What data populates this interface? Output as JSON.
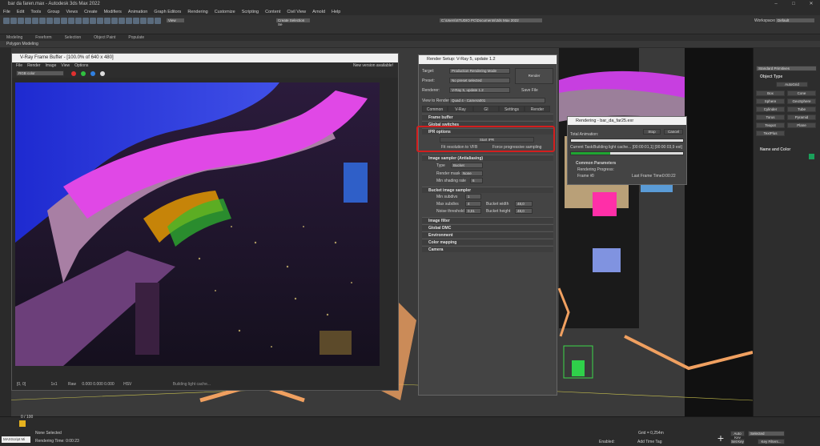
{
  "app": {
    "title": "bar da faren.max - Autodesk 3ds Max 2022"
  },
  "menu": [
    "File",
    "Edit",
    "Tools",
    "Group",
    "Views",
    "Create",
    "Modifiers",
    "Animation",
    "Graph Editors",
    "Rendering",
    "Customize",
    "Scripting",
    "Content",
    "Civil View",
    "Arnold",
    "Help"
  ],
  "toolbar": {
    "view_select": "View",
    "selection_set": "Create Selection Se",
    "path": "C:\\Users\\STUDIO PC\\Documents\\3ds Max 2022",
    "workspace_label": "Workspaces:",
    "workspace_value": "Default"
  },
  "ribbon": {
    "tabs": [
      "Modeling",
      "Freeform",
      "Selection",
      "Object Paint",
      "Populate"
    ],
    "sub": "Polygon Modeling"
  },
  "vfb": {
    "title": "V-Ray Frame Buffer - [100.0% of 640 x 480]",
    "menu": [
      "File",
      "Render",
      "Image",
      "View",
      "Options"
    ],
    "new_version": "New version available!",
    "channel": "RGB color",
    "status_coords": "[0, 0]",
    "status_mode": "1x1",
    "status_raw": "Raw",
    "status_vals": "0.000   0.000   0.000",
    "status_hsv": "HSV",
    "status_msg": "Building light cache..."
  },
  "rs": {
    "title": "Render Setup: V-Ray 5, update 1.2",
    "target_label": "Target:",
    "target_value": "Production Rendering Mode",
    "preset_label": "Preset:",
    "preset_value": "No preset selected",
    "renderer_label": "Renderer:",
    "renderer_value": "V-Ray 5, update 1.2",
    "save_file": "Save File",
    "view_label": "View to Render:",
    "view_value": "Quad 4 - Camera001",
    "render_button": "Render",
    "tabs": [
      "Common",
      "V-Ray",
      "GI",
      "Settings",
      "Render Elements"
    ],
    "rollouts": {
      "frame_buffer": "Frame buffer",
      "global_switches": "Global switches",
      "ipr_options": "IPR options",
      "image_sampler": "Image sampler (Antialiasing)",
      "bucket": "Bucket image sampler",
      "image_filter": "Image filter",
      "global_dmc": "Global DMC",
      "environment": "Environment",
      "color_mapping": "Color mapping",
      "camera": "Camera"
    },
    "ipr": {
      "start": "Start IPR",
      "fit": "Fit resolution to VFB",
      "force": "Force progressive sampling"
    },
    "sampler": {
      "type_label": "Type",
      "type_value": "Bucket",
      "mask_label": "Render mask",
      "mask_value": "None",
      "shading_label": "Min shading rate",
      "shading_value": "6"
    },
    "bucket": {
      "min_label": "Min subdivs",
      "min_value": "1",
      "max_label": "Max subdivs",
      "max_value": "4",
      "noise_label": "Noise threshold",
      "noise_value": "0,01",
      "bw_label": "Bucket width",
      "bw_value": "48,0",
      "bh_label": "Bucket height",
      "bh_value": "48,0"
    }
  },
  "progress": {
    "title": "Rendering - bar_da_far25.exr",
    "stop": "Stop",
    "cancel": "Cancel",
    "total_label": "Total Animation:",
    "task_label": "Current Task:",
    "task_value": "Building light cache... [00:00:01,1] [00:00:03,9 est]",
    "task_fraction": 0.35,
    "common_params": "Common Parameters",
    "rendering_progress": "Rendering Progress:",
    "frame_label": "Frame #",
    "frame_value": "0",
    "last_frame_label": "Last Frame Time:",
    "last_frame_value": "0:00:22"
  },
  "cmd": {
    "dropdown": "Standard Primitives",
    "object_type": "Object Type",
    "autogrid": "AutoGrid",
    "buttons": [
      "Box",
      "Cone",
      "Sphere",
      "GeoSphere",
      "Cylinder",
      "Tube",
      "Torus",
      "Pyramid",
      "Teapot",
      "Plane",
      "TextPlus"
    ],
    "name_color": "Name and Color"
  },
  "status": {
    "frame_counter": "0 / 100",
    "none_selected": "None Selected",
    "rendering_time": "Rendering Time: 0:00:23",
    "maxscript": "MAXScript Mi",
    "grid": "Grid = 0,254m",
    "add_time_tag": "Add Time Tag",
    "enabled": "Enabled:",
    "auto_key": "Auto Key",
    "selected": "Selected",
    "set_key": "Set Key",
    "key_filters": "Key Filters..."
  }
}
